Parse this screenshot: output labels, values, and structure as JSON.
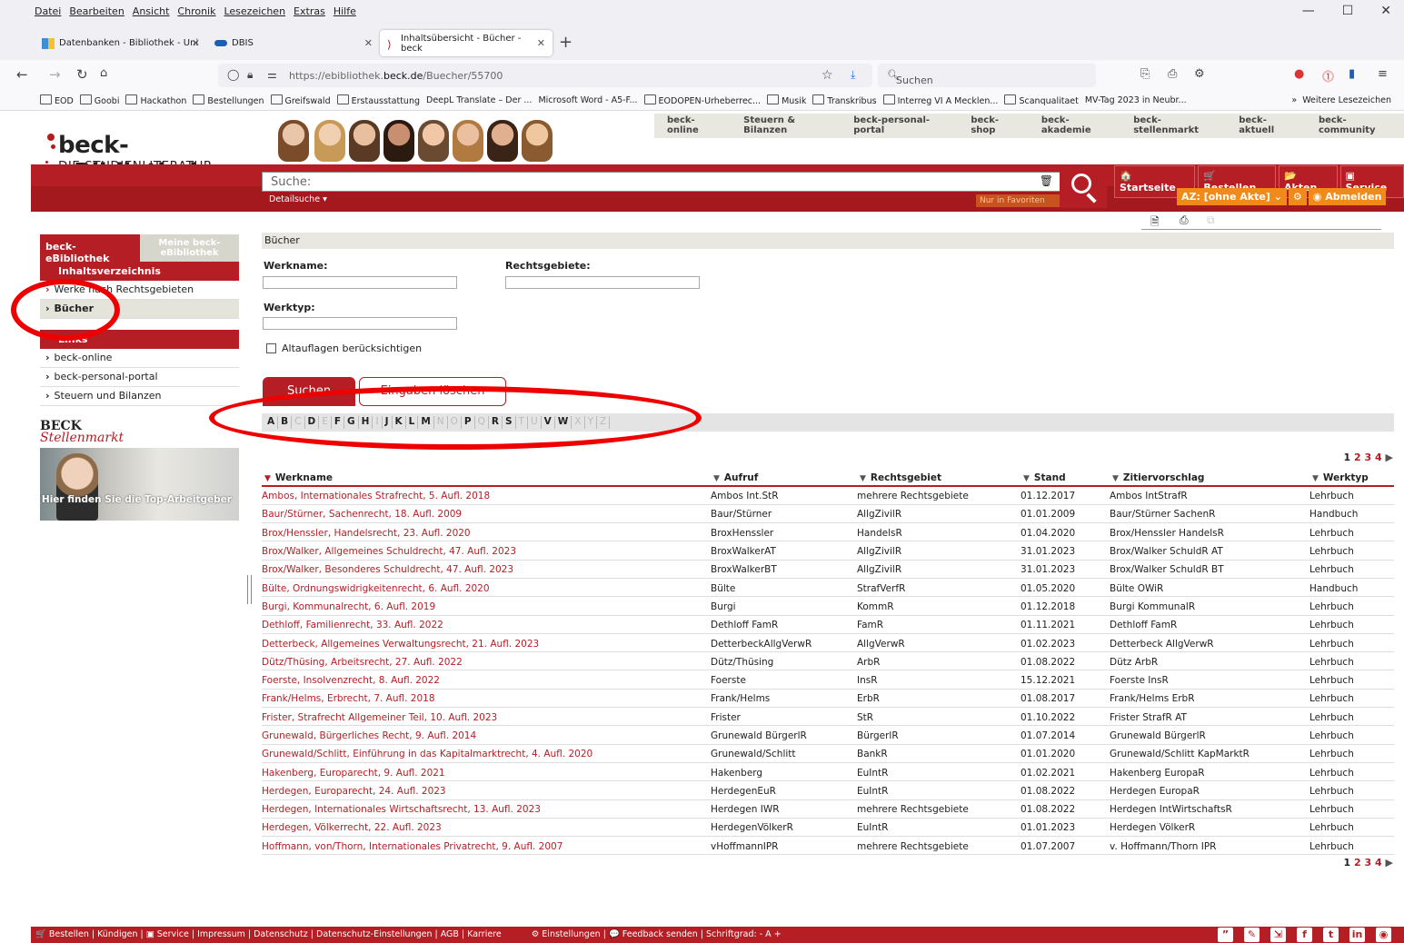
{
  "browser": {
    "menu": [
      "Datei",
      "Bearbeiten",
      "Ansicht",
      "Chronik",
      "Lesezeichen",
      "Extras",
      "Hilfe"
    ],
    "tabs": [
      {
        "label": "Datenbanken - Bibliothek - Uni"
      },
      {
        "label": "DBIS"
      },
      {
        "label": "Inhaltsübersicht - Bücher - beck"
      }
    ],
    "url_prefix": "https://ebibliothek.",
    "url_domain": "beck.de",
    "url_path": "/Buecher/55700",
    "search_placeholder": "Suchen",
    "bookmarks": [
      "EOD",
      "Goobi",
      "Hackathon",
      "Bestellungen",
      "Greifswald",
      "Erstausstattung",
      "DeepL Translate – Der ...",
      "Microsoft Word - A5-F...",
      "EODOPEN-Urheberrec...",
      "Musik",
      "Transkribus",
      "Interreg VI A Mecklen...",
      "Scanqualitaet",
      "MV-Tag 2023 in Neubr..."
    ],
    "bookmarks_more": "Weitere Lesezeichen"
  },
  "site": {
    "logo_name": "beck-eBibliothek",
    "logo_sub": "DIE STUDIENLITERATUR",
    "topnav": [
      "beck-online",
      "Steuern & Bilanzen",
      "beck-personal-portal",
      "beck-shop",
      "beck-akademie",
      "beck-stellenmarkt",
      "beck-aktuell",
      "beck-community"
    ],
    "search_placeholder": "Suche:",
    "detailsuche": "Detailsuche ▾",
    "fav_filter": "Nur in Favoriten",
    "rightnav1": [
      "🏠 Startseite",
      "🛒 Bestellen",
      "📂 Akten",
      "▣ Service"
    ],
    "rightnav2": [
      "AZ: [ohne Akte]  ⌄",
      "⚙",
      "◉ Abmelden"
    ]
  },
  "sidebar": {
    "tab_active": "beck-eBibliothek",
    "tab_inactive": "Meine beck-eBibliothek",
    "section1_title": "Inhaltsverzeichnis",
    "section1_items": [
      "Werke nach Rechtsgebieten",
      "Bücher"
    ],
    "section2_title": "Links",
    "section2_items": [
      "beck-online",
      "beck-personal-portal",
      "Steuern und Bilanzen"
    ],
    "stellen_logo1": "BECK",
    "stellen_logo2": "Stellenmarkt",
    "ad_text": "Hier finden Sie die Top-Arbeitgeber"
  },
  "main": {
    "breadcrumb": "Bücher",
    "label_werkname": "Werkname:",
    "label_rechtsgebiete": "Rechtsgebiete:",
    "label_werktyp": "Werktyp:",
    "altauflagen": "Altauflagen berücksichtigen",
    "btn_search": "Suchen",
    "btn_clear": "Eingaben löschen",
    "alphabet": [
      "A",
      "B",
      "C",
      "D",
      "E",
      "F",
      "G",
      "H",
      "I",
      "J",
      "K",
      "L",
      "M",
      "N",
      "O",
      "P",
      "Q",
      "R",
      "S",
      "T",
      "U",
      "V",
      "W",
      "X",
      "Y",
      "Z"
    ],
    "alphabet_inactive": [
      "C",
      "E",
      "I",
      "N",
      "O",
      "Q",
      "T",
      "U",
      "X",
      "Y",
      "Z"
    ],
    "pager": [
      "1",
      "2",
      "3",
      "4",
      "▶"
    ],
    "columns": [
      "Werkname",
      "Aufruf",
      "Rechtsgebiet",
      "Stand",
      "Zitiervorschlag",
      "Werktyp"
    ],
    "rows": [
      [
        "Ambos, Internationales Strafrecht, 5. Aufl. 2018",
        "Ambos Int.StR",
        "mehrere Rechtsgebiete",
        "01.12.2017",
        "Ambos IntStrafR",
        "Lehrbuch"
      ],
      [
        "Baur/Stürner, Sachenrecht, 18. Aufl. 2009",
        "Baur/Stürner",
        "AllgZivilR",
        "01.01.2009",
        "Baur/Stürner SachenR",
        "Handbuch"
      ],
      [
        "Brox/Henssler, Handelsrecht, 23. Aufl. 2020",
        "BroxHenssler",
        "HandelsR",
        "01.04.2020",
        "Brox/Henssler HandelsR",
        "Lehrbuch"
      ],
      [
        "Brox/Walker, Allgemeines Schuldrecht, 47. Aufl. 2023",
        "BroxWalkerAT",
        "AllgZivilR",
        "31.01.2023",
        "Brox/Walker SchuldR AT",
        "Lehrbuch"
      ],
      [
        "Brox/Walker, Besonderes Schuldrecht, 47. Aufl. 2023",
        "BroxWalkerBT",
        "AllgZivilR",
        "31.01.2023",
        "Brox/Walker SchuldR BT",
        "Lehrbuch"
      ],
      [
        "Bülte, Ordnungswidrigkeitenrecht, 6. Aufl. 2020",
        "Bülte",
        "StrafVerfR",
        "01.05.2020",
        "Bülte OWiR",
        "Handbuch"
      ],
      [
        "Burgi, Kommunalrecht, 6. Aufl. 2019",
        "Burgi",
        "KommR",
        "01.12.2018",
        "Burgi KommunalR",
        "Lehrbuch"
      ],
      [
        "Dethloff, Familienrecht, 33. Aufl. 2022",
        "Dethloff FamR",
        "FamR",
        "01.11.2021",
        "Dethloff FamR",
        "Lehrbuch"
      ],
      [
        "Detterbeck, Allgemeines Verwaltungsrecht, 21. Aufl. 2023",
        "DetterbeckAllgVerwR",
        "AllgVerwR",
        "01.02.2023",
        "Detterbeck AllgVerwR",
        "Lehrbuch"
      ],
      [
        "Dütz/Thüsing, Arbeitsrecht, 27. Aufl. 2022",
        "Dütz/Thüsing",
        "ArbR",
        "01.08.2022",
        "Dütz ArbR",
        "Lehrbuch"
      ],
      [
        "Foerste, Insolvenzrecht, 8. Aufl. 2022",
        "Foerste",
        "InsR",
        "15.12.2021",
        "Foerste InsR",
        "Lehrbuch"
      ],
      [
        "Frank/Helms, Erbrecht, 7. Aufl. 2018",
        "Frank/Helms",
        "ErbR",
        "01.08.2017",
        "Frank/Helms ErbR",
        "Lehrbuch"
      ],
      [
        "Frister, Strafrecht Allgemeiner Teil, 10. Aufl. 2023",
        "Frister",
        "StR",
        "01.10.2022",
        "Frister StrafR AT",
        "Lehrbuch"
      ],
      [
        "Grunewald, Bürgerliches Recht, 9. Aufl. 2014",
        "Grunewald BürgerlR",
        "BürgerlR",
        "01.07.2014",
        "Grunewald BürgerlR",
        "Lehrbuch"
      ],
      [
        "Grunewald/Schlitt, Einführung in das Kapitalmarktrecht, 4. Aufl. 2020",
        "Grunewald/Schlitt",
        "BankR",
        "01.01.2020",
        "Grunewald/Schlitt KapMarktR",
        "Lehrbuch"
      ],
      [
        "Hakenberg, Europarecht, 9. Aufl. 2021",
        "Hakenberg",
        "EuIntR",
        "01.02.2021",
        "Hakenberg EuropaR",
        "Lehrbuch"
      ],
      [
        "Herdegen, Europarecht, 24. Aufl. 2023",
        "HerdegenEuR",
        "EuIntR",
        "01.08.2022",
        "Herdegen EuropaR",
        "Lehrbuch"
      ],
      [
        "Herdegen, Internationales Wirtschaftsrecht, 13. Aufl. 2023",
        "Herdegen IWR",
        "mehrere Rechtsgebiete",
        "01.08.2022",
        "Herdegen IntWirtschaftsR",
        "Lehrbuch"
      ],
      [
        "Herdegen, Völkerrecht, 22. Aufl. 2023",
        "HerdegenVölkerR",
        "EuIntR",
        "01.01.2023",
        "Herdegen VölkerR",
        "Lehrbuch"
      ],
      [
        "Hoffmann, von/Thorn, Internationales Privatrecht, 9. Aufl. 2007",
        "vHoffmannIPR",
        "mehrere Rechtsgebiete",
        "01.07.2007",
        "v. Hoffmann/Thorn IPR",
        "Lehrbuch"
      ]
    ]
  },
  "footer": {
    "left": "🛒 Bestellen | Kündigen | ▣ Service | Impressum | Datenschutz | Datenschutz-Einstellungen | AGB | Karriere",
    "middle": "⚙ Einstellungen | 💬 Feedback senden | Schriftgrad: - A +",
    "social": [
      "”",
      "✎",
      "⇲",
      "f",
      "t",
      "in",
      "◉"
    ]
  },
  "colors": {
    "brand_red": "#b51e24",
    "accent_orange": "#f08a1a",
    "annotation_red": "#ee0000"
  }
}
